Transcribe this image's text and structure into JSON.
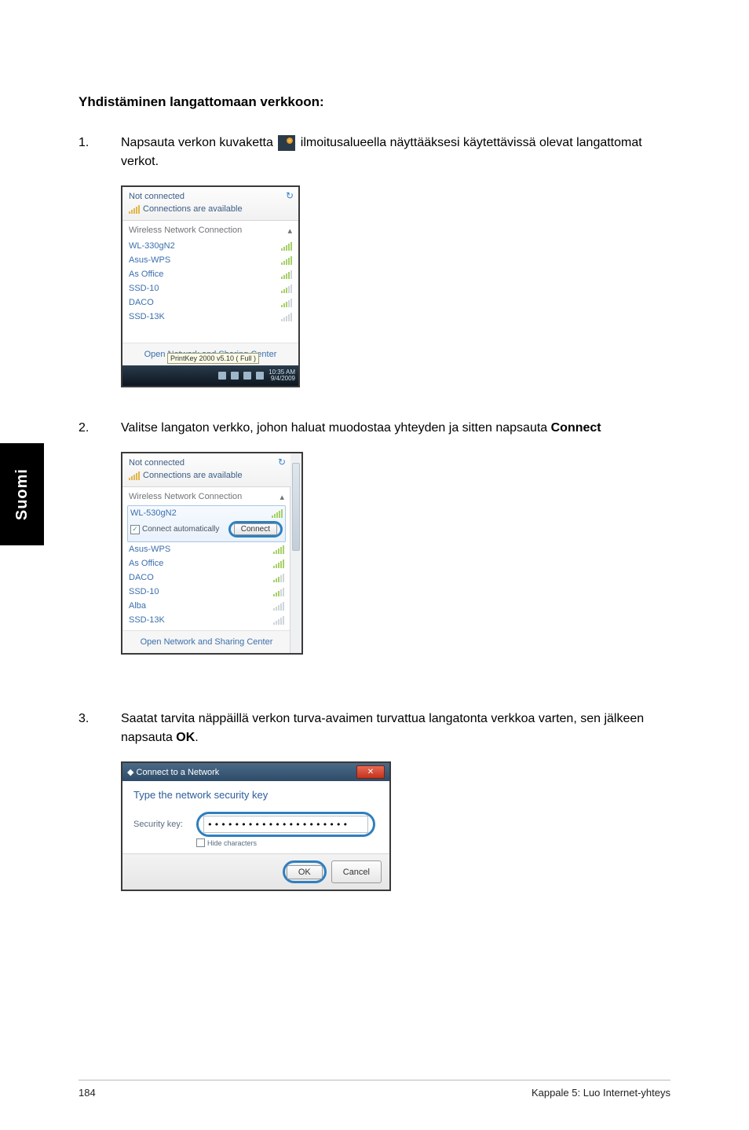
{
  "sidebar_label": "Suomi",
  "heading": "Yhdistäminen langattomaan verkkoon:",
  "steps": {
    "s1_num": "1.",
    "s1_a": "Napsauta verkon kuvaketta ",
    "s1_b": " ilmoitusalueella näyttääksesi käytettävissä olevat langattomat verkot.",
    "s2_num": "2.",
    "s2_a": "Valitse langaton verkko, johon haluat muodostaa yhteyden ja sitten napsauta ",
    "s2_b": "Connect",
    "s3_num": "3.",
    "s3_a": "Saatat tarvita näppäillä verkon turva-avaimen turvattua langatonta verkkoa varten, sen jälkeen napsauta ",
    "s3_b": "OK",
    "s3_c": "."
  },
  "shot1": {
    "not_connected": "Not connected",
    "available": "Connections are available",
    "category": "Wireless Network Connection",
    "cat_arrow": "▴",
    "networks": [
      "WL-330gN2",
      "Asus-WPS",
      "As Office",
      "SSD-10",
      "DACO",
      "SSD-13K"
    ],
    "open_center": "Open Network and Sharing Center",
    "tooltip": "PrintKey 2000 v5.10 ( Full )",
    "time1": "10:35 AM",
    "time2": "9/4/2009"
  },
  "shot2": {
    "not_connected": "Not connected",
    "available": "Connections are available",
    "category": "Wireless Network Connection",
    "cat_arrow": "▴",
    "sel_net": "WL-530gN2",
    "auto_label": "Connect automatically",
    "connect_btn": "Connect",
    "networks": [
      "Asus-WPS",
      "As Office",
      "DACO",
      "SSD-10",
      "Alba",
      "SSD-13K"
    ],
    "open_center": "Open Network and Sharing Center"
  },
  "shot3": {
    "title": "Connect to a Network",
    "prompt": "Type the network security key",
    "label": "Security key:",
    "value": "•••••••••••••••••••••",
    "hide": "Hide characters",
    "ok": "OK",
    "cancel": "Cancel"
  },
  "footer": {
    "page": "184",
    "chapter": "Kappale 5: Luo Internet-yhteys"
  }
}
